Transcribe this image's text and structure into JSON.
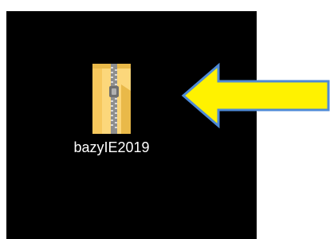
{
  "desktop": {
    "background_color": "#000000",
    "icon": {
      "name": "zip-folder-icon",
      "label": "bazyIE2019",
      "folder_color": "#FCD77B",
      "folder_shade_color": "#E9B949",
      "zipper_color": "#9E9E9E"
    }
  },
  "annotation": {
    "arrow": {
      "fill_color": "#FFF200",
      "outline_color": "#4E8AD6",
      "direction": "left"
    }
  }
}
